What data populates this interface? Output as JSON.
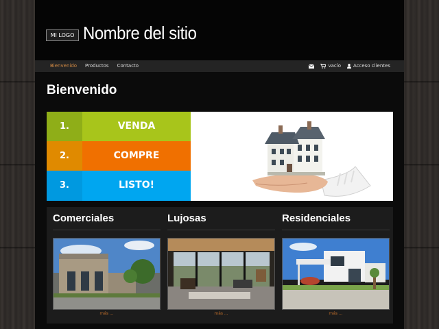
{
  "header": {
    "logo_text": "MI LOGO",
    "site_title": "Nombre del sitio"
  },
  "nav": {
    "left": [
      {
        "label": "Bienvenido",
        "active": true
      },
      {
        "label": "Productos",
        "active": false
      },
      {
        "label": "Contacto",
        "active": false
      }
    ],
    "right": {
      "mail_icon": "envelope-icon",
      "cart_label": "vacío",
      "login_label": "Acceso clientes"
    }
  },
  "main": {
    "heading": "Bienvenido",
    "steps": [
      {
        "num": "1.",
        "word": "VENDA",
        "num_color": "#8fae18",
        "word_color": "#a8c51b"
      },
      {
        "num": "2.",
        "word": "COMPRE",
        "num_color": "#e08a00",
        "word_color": "#f07000"
      },
      {
        "num": "3.",
        "word": "LISTO!",
        "num_color": "#0099e0",
        "word_color": "#00a6f0"
      }
    ],
    "categories": [
      {
        "title": "Comerciales",
        "more": "más ..."
      },
      {
        "title": "Lujosas",
        "more": "más ..."
      },
      {
        "title": "Residenciales",
        "more": "más ..."
      }
    ]
  },
  "colors": {
    "accent": "#d28a44",
    "page_bg": "#0b0b0b"
  }
}
